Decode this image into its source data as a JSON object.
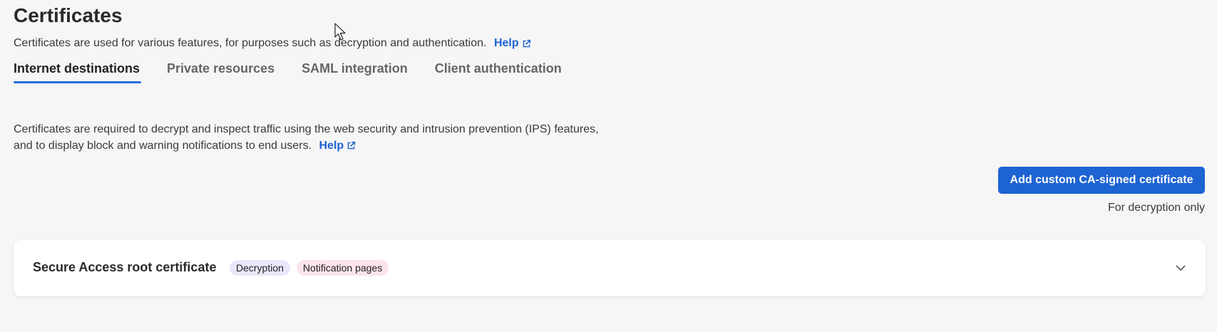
{
  "page": {
    "title": "Certificates",
    "intro": "Certificates are used for various features, for purposes such as decryption and authentication.",
    "help_label": "Help"
  },
  "tabs": [
    {
      "label": "Internet destinations",
      "active": true
    },
    {
      "label": "Private resources",
      "active": false
    },
    {
      "label": "SAML integration",
      "active": false
    },
    {
      "label": "Client authentication",
      "active": false
    }
  ],
  "description": {
    "text": "Certificates are required to decrypt and inspect traffic using the web security and intrusion prevention (IPS) features, and to display block and warning notifications to end users.",
    "help_label": "Help"
  },
  "actions": {
    "add_button_label": "Add custom CA-signed certificate",
    "add_button_caption": "For decryption only"
  },
  "certificate_card": {
    "title": "Secure Access root certificate",
    "badges": [
      "Decryption",
      "Notification pages"
    ],
    "expand_icon": "chevron-down-icon"
  },
  "colors": {
    "accent": "#1d63d2",
    "tab_underline": "#2b6fd6",
    "badge_decryption_bg": "#e8e8fa",
    "badge_notification_bg": "#fde4ea",
    "background": "#f6f6f6"
  }
}
